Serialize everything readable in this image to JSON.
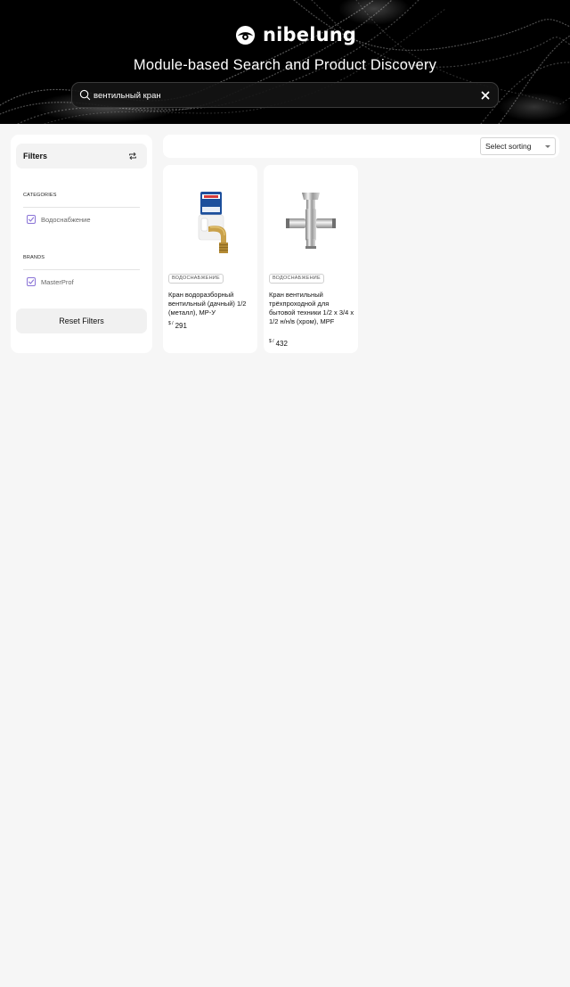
{
  "brand": {
    "name": "nibelung"
  },
  "hero": {
    "title": "Module-based Search and Product Discovery"
  },
  "search": {
    "value": "вентильный кран"
  },
  "sidebar": {
    "title": "Filters",
    "categories": {
      "label": "CATEGORIES",
      "items": [
        {
          "label": "Водоснабжение",
          "checked": true
        }
      ]
    },
    "brands": {
      "label": "BRANDS",
      "items": [
        {
          "label": "MasterProf",
          "checked": true
        }
      ]
    },
    "reset_label": "Reset Filters"
  },
  "toolbar": {
    "sort_label": "Select sorting"
  },
  "products": [
    {
      "category": "ВОДОСНАБЖЕНИЕ",
      "title": "Кран водоразборный вентильный (дачный) 1/2 (металл), МР-У",
      "currency": "$ /",
      "price": "291"
    },
    {
      "category": "ВОДОСНАБЖЕНИЕ",
      "title": "Кран вентильный трёхпроходной для бытовой техники 1/2 х 3/4 х 1/2 н/н/в (хром), MPF",
      "currency": "$ /",
      "price": "432"
    }
  ],
  "colors": {
    "accent": "#8a73d6",
    "hero_bg": "#000000",
    "page_bg": "#f6f6f6"
  }
}
